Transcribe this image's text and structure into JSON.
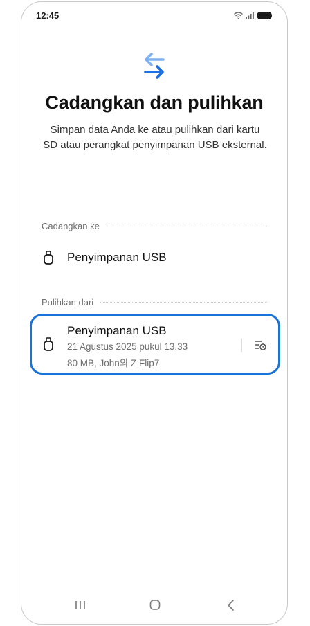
{
  "status_bar": {
    "time": "12:45",
    "wifi_icon": "wifi-icon",
    "signal_icon": "signal-icon",
    "battery_icon": "battery-icon"
  },
  "header": {
    "icon": "transfer-arrows-icon",
    "title": "Cadangkan dan pulihkan",
    "subtitle": "Simpan data Anda ke atau pulihkan dari kartu SD atau perangkat penyimpanan USB eksternal."
  },
  "backup_section": {
    "label": "Cadangkan ke",
    "items": [
      {
        "icon": "usb-storage-icon",
        "title": "Penyimpanan USB"
      }
    ]
  },
  "restore_section": {
    "label": "Pulihkan dari",
    "items": [
      {
        "icon": "usb-storage-icon",
        "title": "Penyimpanan USB",
        "date": "21 Agustus 2025 pukul 13.33",
        "details": "80 MB, John의 Z Flip7",
        "action_icon": "backup-history-icon"
      }
    ]
  },
  "colors": {
    "accent": "#1a73d9",
    "icon_blue_light": "#7fb0f2",
    "icon_blue_dark": "#1f6fe0",
    "text_primary": "#111111",
    "text_secondary": "#6e6e6e"
  },
  "navbar": {
    "recents_icon": "recents-icon",
    "home_icon": "home-icon",
    "back_icon": "back-icon"
  }
}
